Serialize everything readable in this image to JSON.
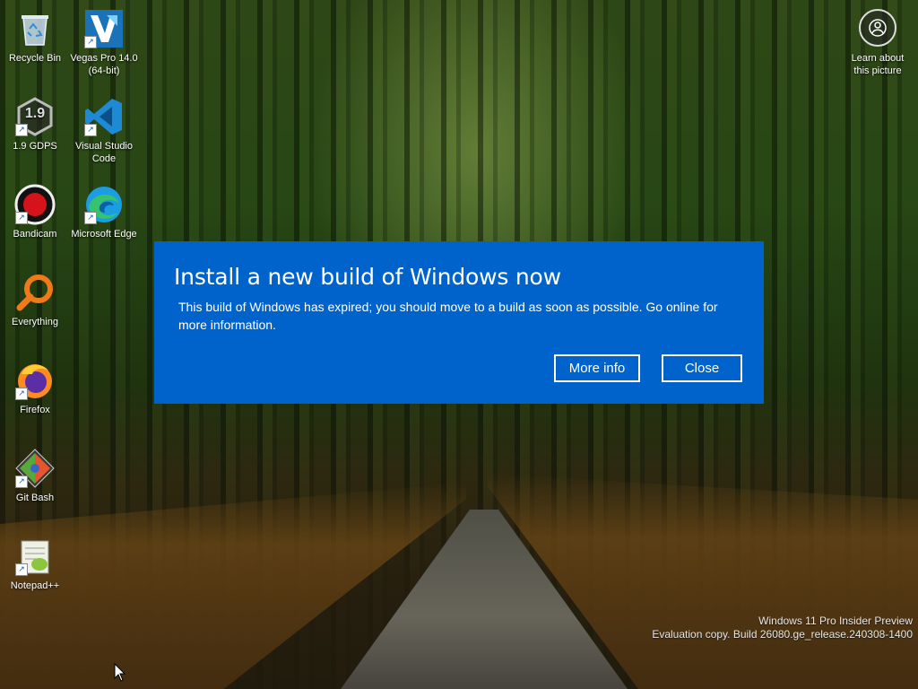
{
  "desktop_icons": [
    {
      "label": "Recycle Bin",
      "icon": "recycle-bin-icon"
    },
    {
      "label": "Vegas Pro 14.0 (64-bit)",
      "icon": "vegas-pro-icon"
    },
    {
      "label": "1.9 GDPS",
      "icon": "gdps-icon"
    },
    {
      "label": "Visual Studio Code",
      "icon": "vscode-icon"
    },
    {
      "label": "Bandicam",
      "icon": "bandicam-icon"
    },
    {
      "label": "Microsoft Edge",
      "icon": "edge-icon"
    },
    {
      "label": "Everything",
      "icon": "everything-icon"
    },
    {
      "label": "Firefox",
      "icon": "firefox-icon"
    },
    {
      "label": "Git Bash",
      "icon": "git-bash-icon"
    },
    {
      "label": "Notepad++",
      "icon": "notepad-plus-plus-icon"
    }
  ],
  "gdps_badge": "1.9",
  "learn_about": {
    "label": "Learn about this picture",
    "icon": "camera-icon"
  },
  "dialog": {
    "title": "Install a new build of Windows now",
    "message": "This build of Windows has expired; you should move to a build as soon as possible. Go online for more information.",
    "more_info_label": "More info",
    "close_label": "Close",
    "background_color": "#0063cc"
  },
  "watermark": {
    "line1": "Windows 11 Pro Insider Preview",
    "line2": "Evaluation copy. Build 26080.ge_release.240308-1400"
  }
}
